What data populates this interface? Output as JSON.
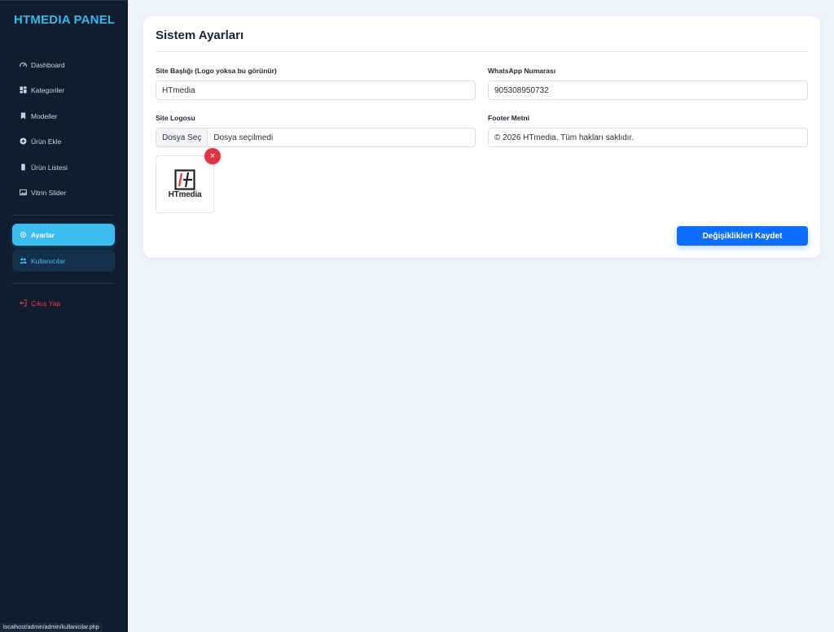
{
  "brand": {
    "title": "HTMEDIA PANEL"
  },
  "sidebar": {
    "items": [
      {
        "label": "Dashboard",
        "icon": "speedometer-icon"
      },
      {
        "label": "Kategoriler",
        "icon": "grid-icon"
      },
      {
        "label": "Modeller",
        "icon": "bookmark-icon"
      },
      {
        "label": "Ürün Ekle",
        "icon": "plus-circle-icon"
      },
      {
        "label": "Ürün Listesi",
        "icon": "phone-icon"
      },
      {
        "label": "Vitrin Slider",
        "icon": "image-icon"
      },
      {
        "label": "Ayarlar",
        "icon": "gear-icon",
        "active": true
      },
      {
        "label": "Kullanıcılar",
        "icon": "people-icon"
      },
      {
        "label": "Çıkış Yap",
        "icon": "logout-icon"
      }
    ]
  },
  "statusbar": {
    "url": "localhost/admin/admin/kullanicilar.php"
  },
  "settings": {
    "title": "Sistem Ayarları",
    "site_title": {
      "label": "Site Başlığı (Logo yoksa bu görünür)",
      "value": "HTmedia"
    },
    "whatsapp": {
      "label": "WhatsApp Numarası",
      "value": "905308950732"
    },
    "logo": {
      "label": "Site Logosu",
      "button": "Dosya Seç",
      "filename": "Dosya seçilmedi",
      "preview_text": "HTmedia",
      "remove_symbol": "×"
    },
    "footer": {
      "label": "Footer Metni",
      "value": "© 2026 HTmedia. Tüm hakları saklıdır."
    },
    "save_button": "Değişiklikleri Kaydet"
  },
  "colors": {
    "sidebar_bg": "#111c2f",
    "accent": "#3bbdf2",
    "primary": "#0d6efd",
    "danger": "#dc3545",
    "logout": "#e0404c"
  }
}
